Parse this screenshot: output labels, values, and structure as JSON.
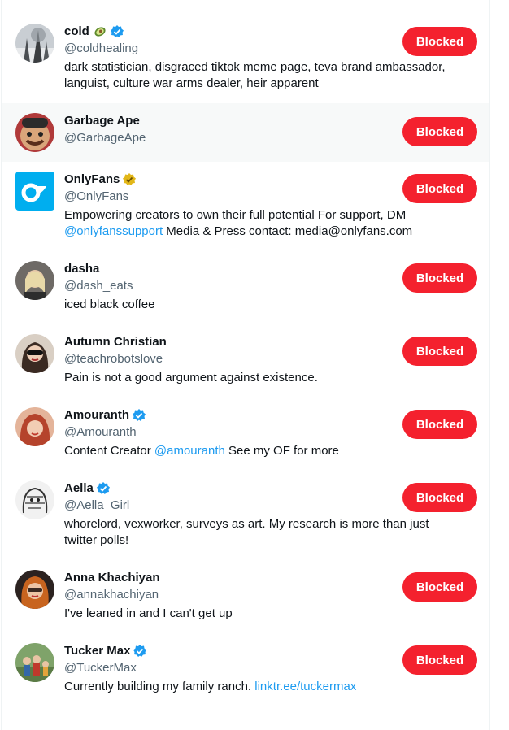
{
  "button_label": "Blocked",
  "accounts": [
    {
      "name": "cold",
      "handle": "@coldhealing",
      "verified": "blue",
      "emoji": "avocado",
      "bio": "dark statistician, disgraced tiktok meme page, teva brand ambassador, languist, culture war arms dealer, heir apparent"
    },
    {
      "name": "Garbage Ape",
      "handle": "@GarbageApe",
      "bio": ""
    },
    {
      "name": "OnlyFans",
      "handle": "@OnlyFans",
      "verified": "gold",
      "bio_pre": "Empowering creators to own their full potential For support, DM",
      "bio_link": "@onlyfanssupport",
      "bio_post": " Media & Press contact: media@onlyfans.com"
    },
    {
      "name": "dasha",
      "handle": "@dash_eats",
      "bio": "iced black coffee"
    },
    {
      "name": "Autumn Christian",
      "handle": "@teachrobotslove",
      "bio": "Pain is not a good argument against existence."
    },
    {
      "name": "Amouranth",
      "handle": "@Amouranth",
      "verified": "blue",
      "bio_pre": "Content Creator ",
      "bio_link": "@amouranth",
      "bio_post": " See my OF for more"
    },
    {
      "name": "Aella",
      "handle": "@Aella_Girl",
      "verified": "blue",
      "bio": "whorelord, vexworker, surveys as art. My research is more than just twitter polls!"
    },
    {
      "name": "Anna Khachiyan",
      "handle": "@annakhachiyan",
      "bio": "I've leaned in and I can't get up"
    },
    {
      "name": "Tucker Max",
      "handle": "@TuckerMax",
      "verified": "blue",
      "bio_pre": "Currently building my family ranch. ",
      "bio_link": "linktr.ee/tuckermax",
      "bio_post": ""
    }
  ],
  "colors": {
    "accent": "#1d9bf0",
    "blocked": "#f4212e",
    "gold": "#e2b719"
  }
}
